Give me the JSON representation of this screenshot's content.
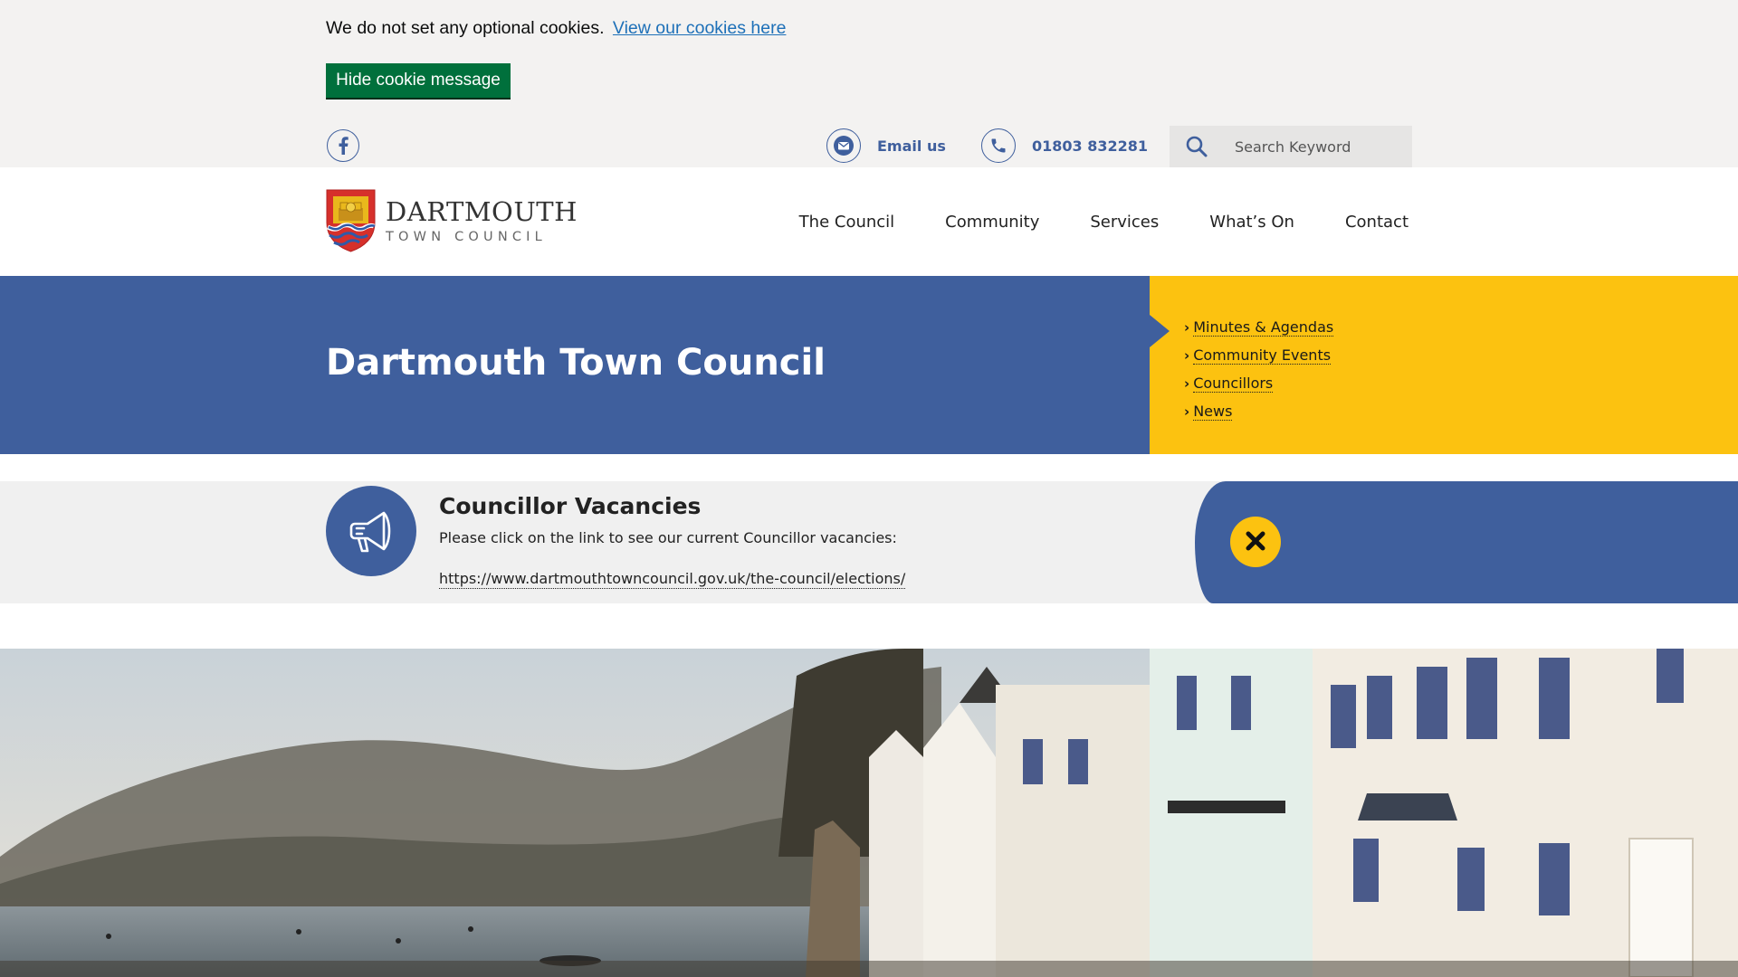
{
  "cookie_banner": {
    "message": "We do not set any optional cookies.",
    "link_text": "View our cookies here",
    "button_label": "Hide cookie message"
  },
  "utility": {
    "social": "facebook-icon",
    "email_label": "Email us",
    "phone_label": "01803 832281",
    "search_placeholder": "Search Keyword"
  },
  "header": {
    "logo_name": "DARTMOUTH",
    "logo_sub": "TOWN COUNCIL",
    "nav": [
      {
        "label": "The Council"
      },
      {
        "label": "Community"
      },
      {
        "label": "Services"
      },
      {
        "label": "What’s On"
      },
      {
        "label": "Contact"
      }
    ]
  },
  "hero": {
    "title": "Dartmouth Town Council",
    "quick_links": [
      {
        "label": "Minutes & Agendas"
      },
      {
        "label": "Community Events"
      },
      {
        "label": "Councillors"
      },
      {
        "label": "News"
      }
    ]
  },
  "alert": {
    "icon": "megaphone-icon",
    "title": "Councillor Vacancies",
    "body": "Please click on the link to see our current Councillor vacancies:",
    "link": "https://www.dartmouthtowncouncil.gov.uk/the-council/elections/",
    "close_icon": "close-icon"
  },
  "colors": {
    "brand_blue": "#3f5f9d",
    "brand_yellow": "#fcc210",
    "cookie_green": "#00703c",
    "link_blue": "#1d70b8"
  }
}
